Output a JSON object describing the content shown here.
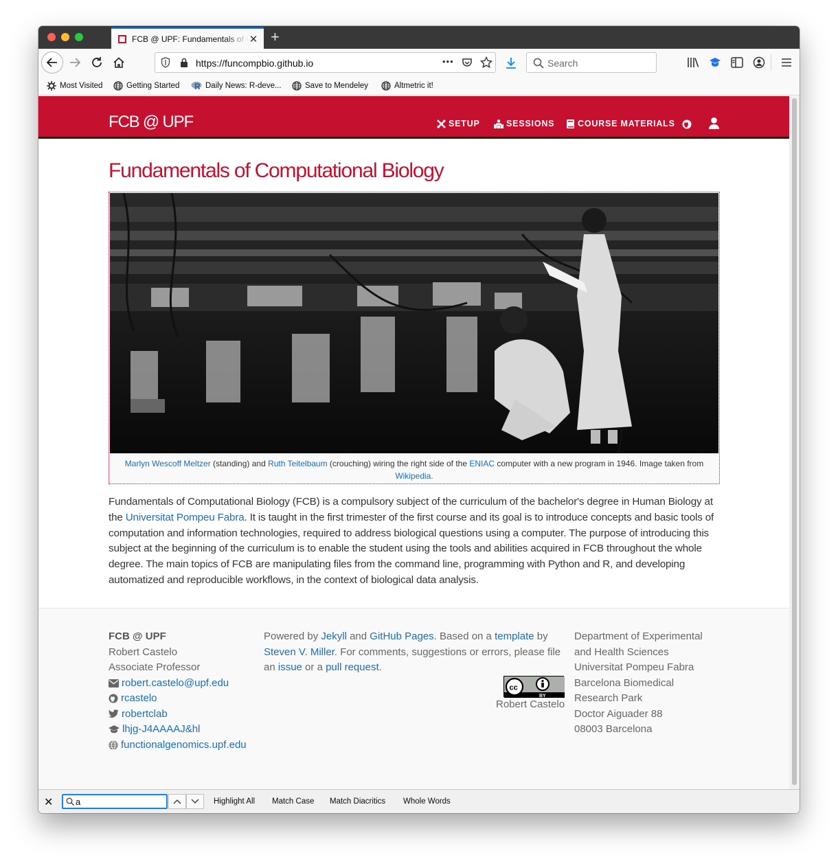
{
  "browser": {
    "tab_title": "FCB @ UPF: Fundamentals of Computational Biology",
    "new_tab": "+",
    "url": "https://funcompbio.github.io",
    "search_placeholder": "Search",
    "page_actions": "•••",
    "bookmarks": [
      "Most Visited",
      "Getting Started",
      "Daily News:  R-deve...",
      "Save to Mendeley",
      "Altmetric it!"
    ]
  },
  "site": {
    "brand": "FCB @ UPF",
    "nav": [
      "SETUP",
      "SESSIONS",
      "COURSE MATERIALS"
    ],
    "title": "Fundamentals of Computational Biology",
    "caption": {
      "person1": "Marlyn Wescoff Meltzer",
      "text1": " (standing) and ",
      "person2": "Ruth Teitelbaum",
      "text2": " (crouching) wiring the right side of the ",
      "eniac": "ENIAC",
      "text3": " computer with a new program in 1946. Image taken from ",
      "wiki": "Wikipedia",
      "end": "."
    },
    "intro": {
      "p1": "Fundamentals of Computational Biology (FCB) is a compulsory subject of the curriculum of the bachelor's degree in Human Biology at the ",
      "link": "Universitat Pompeu Fabra",
      "p2": ". It is taught in the first trimester of the first course and its goal is to introduce concepts and basic tools of computation and information technologies, required to address biological questions using a computer. The purpose of introducing this subject at the beginning of the curriculum is to enable the student using the tools and abilities acquired in FCB throughout the whole degree. The main topics of FCB are manipulating files from the command line, programming with Python and R, and developing automatized and reproducible workflows, in the context of biological data analysis."
    },
    "footer": {
      "name": "FCB @ UPF",
      "author": "Robert Castelo",
      "role": "Associate Professor",
      "email": "robert.castelo@upf.edu",
      "github": "rcastelo",
      "twitter": "robertclab",
      "scholar": "lhjg-J4AAAAJ&hl",
      "web": "functionalgenomics.upf.edu",
      "powered": "Powered by ",
      "jekyll": "Jekyll",
      "and": " and ",
      "ghpages": "GitHub Pages",
      "based": ". Based on a ",
      "template": "template",
      "by": " by ",
      "miller": "Steven V. Miller",
      "comments": ". For comments, suggestions or errors, please file an ",
      "issue": "issue",
      "or": " or a ",
      "pr": "pull request",
      "period": ".",
      "cc_author": "Robert Castelo",
      "address": [
        "Department of Experimental",
        "and Health Sciences",
        "Universitat Pompeu Fabra",
        "Barcelona Biomedical",
        "Research Park",
        "Doctor Aiguader 88",
        "08003 Barcelona"
      ]
    }
  },
  "findbar": {
    "value": "a",
    "options": [
      "Highlight All",
      "Match Case",
      "Match Diacritics",
      "Whole Words"
    ]
  },
  "colors": {
    "brand_red": "#c5102f",
    "link": "#1a6dbb",
    "accent_blue": "#0a84ff"
  }
}
